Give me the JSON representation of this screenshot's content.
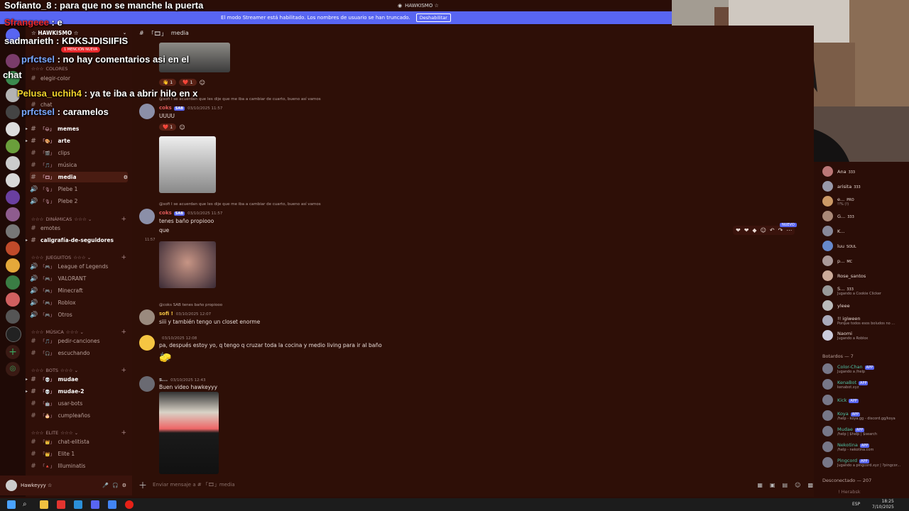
{
  "window_title": "HAWKISMO ☆",
  "banner": {
    "text": "El modo Streamer está habilitado. Los nombres de usuario se han truncado.",
    "button": "Deshabilitar"
  },
  "server_name": "☆ HAWKISMO ☆",
  "mention_badge": "1 MENCIÓN NUEVA",
  "sidebar": {
    "cat_colores": "COLORES",
    "ch_elegir_color": "elegir-color",
    "ch_chat": "chat",
    "channels_top": [
      {
        "label": "memes",
        "bold": true
      },
      {
        "label": "arte",
        "bold": true
      },
      {
        "label": "clips",
        "bold": false
      },
      {
        "label": "música",
        "bold": false
      },
      {
        "label": "media",
        "bold": true
      }
    ],
    "voice_top": [
      "Plebe 1",
      "Plebe 2"
    ],
    "cat_dinamicas": "DINÁMICAS",
    "ch_emotes": "emotes",
    "ch_caligrafia": "caligrafía-de-seguidores",
    "cat_juegitos": "JUEGUITOS",
    "voice_games": [
      "League of Legends",
      "VALORANT",
      "Minecraft",
      "Roblox",
      "Otros"
    ],
    "cat_musica": "MÚSICA",
    "ch_music": [
      "pedir-canciones",
      "escuchando"
    ],
    "cat_bots": "BOTS",
    "ch_bots": [
      {
        "label": "mudae",
        "bold": true
      },
      {
        "label": "mudae-2",
        "bold": true
      },
      {
        "label": "usar-bots",
        "bold": false
      },
      {
        "label": "cumpleaños",
        "bold": false
      }
    ],
    "cat_elite": "ELITE",
    "ch_elite": [
      "chat-elitista",
      "Elite 1",
      "Illuminatis"
    ]
  },
  "user": {
    "name": "Hawkeyyy ☆"
  },
  "chat_header": "media",
  "messages": {
    "r1": "@sofi I se acuerdan que les dije que me iba a cambiar de cuarto, bueno así vamos",
    "m1_user": "coks",
    "m1_ts": "03/10/2025 11:57",
    "m1_text": "UUUU",
    "r2": "@sofi I se acuerdan que les dije que me iba a cambiar de cuarto, bueno así vamos",
    "m2_user": "coks",
    "m2_ts": "03/10/2025 11:57",
    "m2_text1": "tenes baño propiooo",
    "m2_text2": "que",
    "m2_side_ts": "11:57",
    "r3": "@coks  SAB  tenes baño propiooo",
    "m3_user": "sofi !",
    "m3_ts": "03/10/2025 12:07",
    "m3_text": "siii y también tengo un closet enorme",
    "m4_ts": "03/10/2025 12:08",
    "m4_text": "pa, después estoy yo, q tengo q cruzar toda la cocina y medio living para ir al baño",
    "m5_user": "s...",
    "m5_ts": "03/10/2025 12:43",
    "m5_text": "Buen video hawkeyyy",
    "tag_sab": "SAB",
    "react_count": "1",
    "nuevo": "NUEVO"
  },
  "composer_placeholder": "Enviar mensaje a # 「🎞」media",
  "members": {
    "online": [
      {
        "name": "Ana",
        "badge": "333",
        "status": ""
      },
      {
        "name": "arisita",
        "badge": "333",
        "status": ""
      },
      {
        "name": "e...",
        "badge": "PRO",
        "status": "!!% (!)"
      },
      {
        "name": "G...",
        "badge": "333",
        "status": ""
      },
      {
        "name": "K...",
        "badge": "",
        "status": ""
      },
      {
        "name": "luu",
        "badge": "SOUL",
        "status": ""
      },
      {
        "name": "p...",
        "badge": "MC",
        "status": ""
      },
      {
        "name": "Rose_santos",
        "badge": "",
        "status": ""
      },
      {
        "name": "S...",
        "badge": "333",
        "status": "Jugando a Cookie Clicker"
      },
      {
        "name": "yleee",
        "badge": "",
        "status": ""
      },
      {
        "name": "!! igiween",
        "badge": "",
        "status": "Porque todos esos boludos no ..."
      },
      {
        "name": "Naomi",
        "badge": "",
        "status": "Jugando a Roblox"
      }
    ],
    "bots_header": "Botardos — 7",
    "bots": [
      {
        "name": "Color-Chan",
        "status": "Jugando a /help"
      },
      {
        "name": "KenaBot",
        "status": "kenabot.xyz"
      },
      {
        "name": "Kick",
        "status": ""
      },
      {
        "name": "Koya",
        "status": "/help - koya.gg - discord.gg/koya"
      },
      {
        "name": "Mudae",
        "status": "/help | $help | $search"
      },
      {
        "name": "Nekotina",
        "status": "/help - nekotina.com"
      },
      {
        "name": "Pingcord",
        "status": "Jugando a pingcord.xyz | ?pingcor..."
      }
    ],
    "app_tag": "APP",
    "offline_header": "Desconectado — 207",
    "offline_first": "! Herabsk"
  },
  "twitch_chat": [
    {
      "user": "Sofianto_8",
      "text": "para que no se manche la puerta",
      "color": "#ffffff"
    },
    {
      "user": "Sfrangeee",
      "text": "e",
      "color": "#e8272b"
    },
    {
      "user": "sadmarieth",
      "text": "KDKSJDISIIFIS",
      "color": "#ffffff"
    },
    {
      "user": "prfctsel",
      "text": "no hay comentarios asi en el",
      "color": "#7aa8ff"
    },
    {
      "user": "",
      "text": "chat",
      "color": "#ffffff"
    },
    {
      "user": "Pelusa_uchih4",
      "text": "ya te iba a abrir hilo en x",
      "color": "#f2d42b"
    },
    {
      "user": "prfctsel",
      "text": "caramelos",
      "color": "#7aa8ff"
    }
  ],
  "taskbar": {
    "time": "18:25",
    "date": "7/10/2025",
    "lang": "ESP"
  },
  "colors": {
    "blurple": "#5865f2",
    "bg": "#2e0f07",
    "accent_bot": "#4ec2a6"
  }
}
